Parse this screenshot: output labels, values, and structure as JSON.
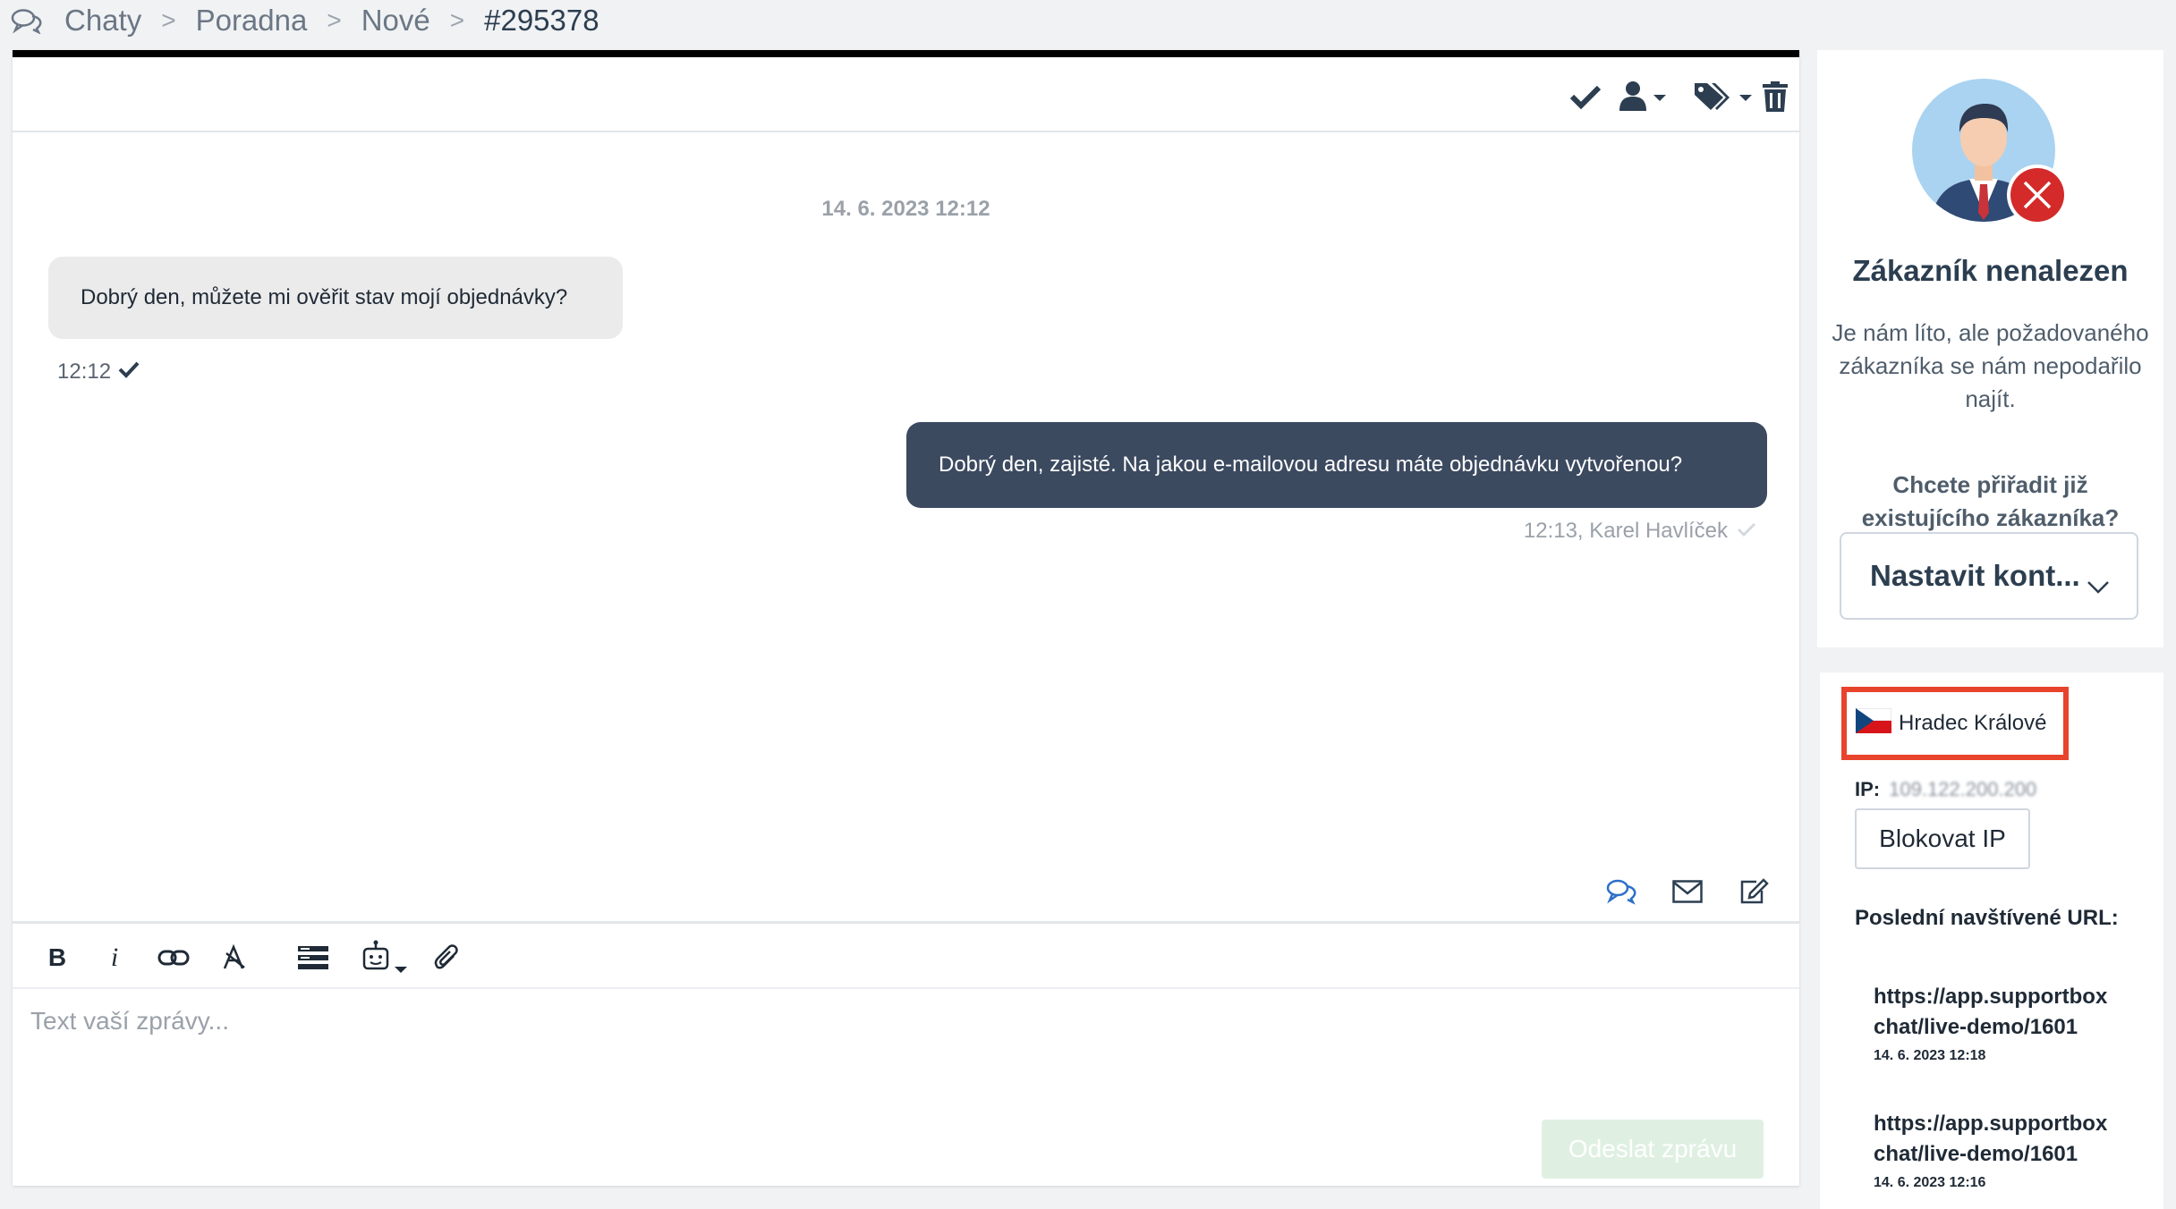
{
  "breadcrumb": {
    "items": [
      "Chaty",
      "Poradna",
      "Nové",
      "#295378"
    ],
    "separator": ">"
  },
  "chat": {
    "date_separator": "14. 6. 2023 12:12",
    "messages": [
      {
        "direction": "incoming",
        "text": "Dobrý den, můžete mi ověřit stav mojí objednávky?",
        "meta": "12:12"
      },
      {
        "direction": "outgoing",
        "text": "Dobrý den, zajisté. Na jakou e-mailovou adresu máte objednávku vytvořenou?",
        "meta": "12:13, Karel Havlíček"
      }
    ]
  },
  "toolbar_icons": [
    "check-icon",
    "assign-user-icon",
    "tags-icon",
    "trash-icon"
  ],
  "action_icons": [
    "chat-bubbles-icon",
    "envelope-icon",
    "edit-note-icon"
  ],
  "composer": {
    "format_buttons": [
      {
        "name": "bold-button",
        "label": "B"
      },
      {
        "name": "italic-button",
        "label": "i"
      }
    ],
    "placeholder": "Text vaší zprávy...",
    "send_label": "Odeslat zprávu"
  },
  "customer": {
    "title": "Zákazník nenalezen",
    "text": "Je nám líto, ale požadovaného zákazníka se nám nepodařilo najít.",
    "link": "Chcete přiřadit již existujícího zákazníka?",
    "select_value": "Nastavit kont..."
  },
  "visitor": {
    "location": "Hradec Králové",
    "ip_label": "IP:",
    "ip_value": "109.122.200.200",
    "block_label": "Blokovat IP",
    "urls_title": "Poslední navštívené URL:",
    "urls": [
      {
        "url": "https://app.supportbox chat/live-demo/1601",
        "time": "14. 6. 2023 12:18"
      },
      {
        "url": "https://app.supportbox chat/live-demo/1601",
        "time": "14. 6. 2023 12:16"
      }
    ]
  },
  "colors": {
    "outgoing_bubble": "#3c4a60",
    "incoming_bubble": "#ebebeb",
    "highlight_box": "#e8432c",
    "send_button": "#dff0e2",
    "not_found_badge": "#d42a2a"
  }
}
